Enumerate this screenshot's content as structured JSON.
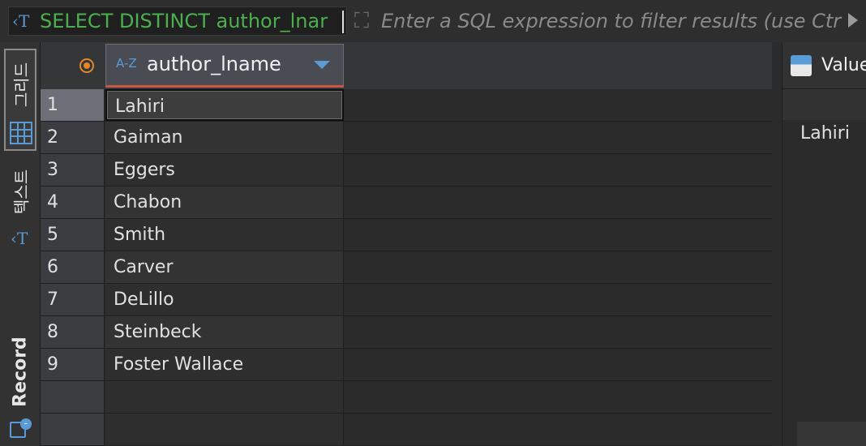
{
  "filter": {
    "query_text": "SELECT DISTINCT author_lnar",
    "placeholder": "Enter a SQL expression to filter results (use Ctr"
  },
  "side_tabs": {
    "grid_label": "그리드",
    "text_label": "텍스트",
    "record_label": "Record"
  },
  "grid": {
    "az_label": "A-Z",
    "column_name": "author_lname",
    "rows": [
      {
        "num": "1",
        "value": "Lahiri"
      },
      {
        "num": "2",
        "value": "Gaiman"
      },
      {
        "num": "3",
        "value": "Eggers"
      },
      {
        "num": "4",
        "value": "Chabon"
      },
      {
        "num": "5",
        "value": "Smith"
      },
      {
        "num": "6",
        "value": "Carver"
      },
      {
        "num": "7",
        "value": "DeLillo"
      },
      {
        "num": "8",
        "value": "Steinbeck"
      },
      {
        "num": "9",
        "value": "Foster Wallace"
      }
    ]
  },
  "value_panel": {
    "title": "Value",
    "value": "Lahiri"
  },
  "colors": {
    "query_green": "#4caf4f",
    "accent_blue": "#5b9bd5",
    "pin_orange": "#e0872e",
    "header_underline": "#c7583f"
  }
}
